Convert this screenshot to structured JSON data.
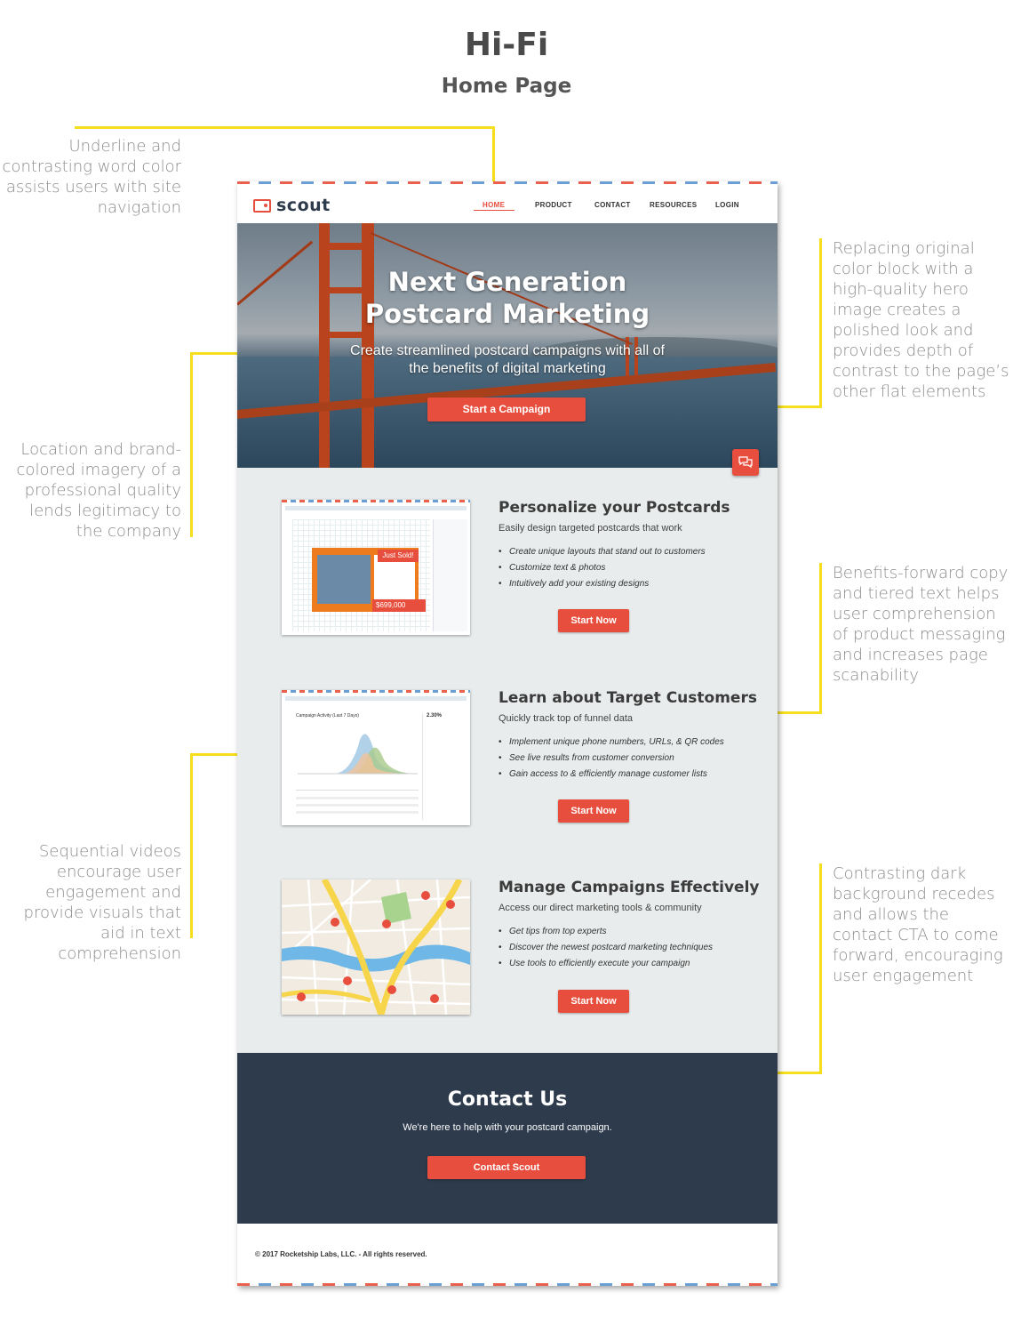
{
  "heading": {
    "title": "Hi-Fi",
    "subtitle": "Home Page"
  },
  "annotations": {
    "left": [
      "Underline and contrasting word color assists users with site navigation",
      "Location and brand-colored imagery of a professional quality lends legitimacy to the company",
      "Sequential videos encourage user engagement and provide visuals that aid in text comprehension"
    ],
    "right": [
      "Replacing original color block with a high-quality hero image creates a polished look and provides depth of contrast to the page’s other flat elements",
      "Benefits-forward copy and tiered text helps user comprehension of product messaging and increases page scanability",
      "Contrasting dark background recedes and allows the contact CTA to come forward, encouraging user engagement"
    ]
  },
  "site": {
    "logo": "scout",
    "nav": [
      "HOME",
      "PRODUCT",
      "CONTACT",
      "RESOURCES",
      "LOGIN"
    ],
    "hero": {
      "title_line1": "Next Generation",
      "title_line2": "Postcard Marketing",
      "subtitle": "Create streamlined postcard campaigns with all of the benefits of digital marketing",
      "cta": "Start a Campaign"
    },
    "features": [
      {
        "title": "Personalize your Postcards",
        "subtitle": "Easily design targeted postcards that work",
        "bullets": [
          "Create unique layouts that stand out to customers",
          "Customize text & photos",
          "Intuitively add your existing designs"
        ],
        "cta": "Start Now"
      },
      {
        "title": "Learn about Target Customers",
        "subtitle": "Quickly track top of funnel data",
        "bullets": [
          "Implement unique phone numbers, URLs, & QR codes",
          "See live results from customer conversion",
          "Gain access to & efficiently manage customer lists"
        ],
        "cta": "Start Now"
      },
      {
        "title": "Manage Campaigns Effectively",
        "subtitle": "Access our direct marketing tools & community",
        "bullets": [
          "Get tips from top experts",
          "Discover the newest postcard marketing techniques",
          "Use tools to efficiently execute your campaign"
        ],
        "cta": "Start Now"
      }
    ],
    "mini": {
      "just_sold": "Just Sold!",
      "price": "$699,000",
      "chart_title": "Campaign Activity (Last 7 Days)",
      "stat": "2.30%"
    },
    "contact": {
      "title": "Contact Us",
      "subtitle": "We're here to help with your postcard campaign.",
      "cta": "Contact Scout"
    },
    "footer": "© 2017 Rocketship Labs, LLC. - All rights reserved."
  },
  "colors": {
    "accent": "#e84e3d",
    "dark": "#2d3b4c",
    "highlight": "#f5df1c",
    "section_bg": "#e9ecec"
  }
}
